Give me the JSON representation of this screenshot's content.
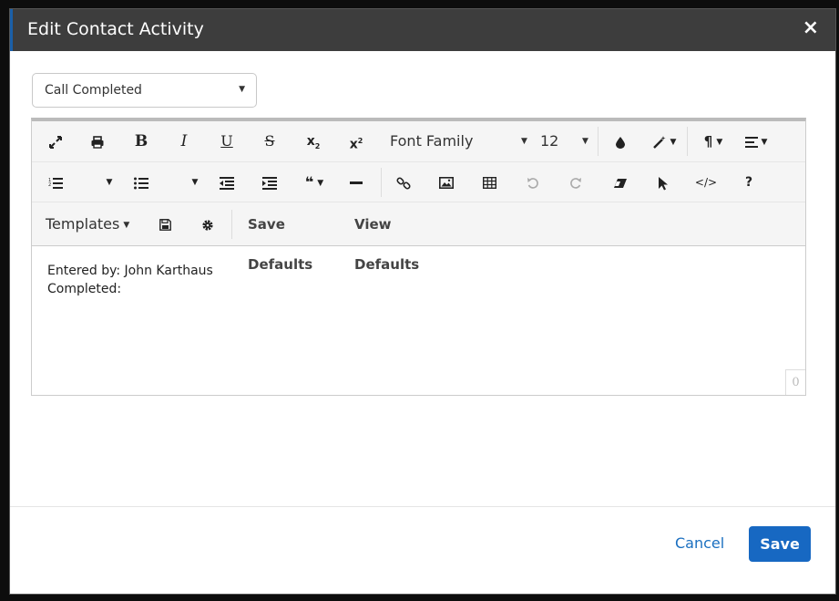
{
  "modal": {
    "title": "Edit Contact Activity",
    "close_glyph": "×"
  },
  "activity_select": {
    "value": "Call Completed"
  },
  "toolbar": {
    "font_family": "Font Family",
    "font_size": "12",
    "templates": "Templates",
    "save_defaults": "Save Defaults",
    "view_defaults": "View Defaults",
    "bold": "B",
    "italic": "I",
    "underline": "U",
    "strike": "S",
    "subscript": "x",
    "superscript": "x",
    "sub_mark": "2",
    "sup_mark": "2",
    "help": "?",
    "code": "</>"
  },
  "editor": {
    "lines": [
      "Entered by: John Karthaus",
      "Completed:"
    ],
    "char_count": "0"
  },
  "footer": {
    "cancel_label": "Cancel",
    "save_label": "Save"
  },
  "colors": {
    "header_bg": "#3d3d3d",
    "primary": "#1768c2",
    "link": "#1a6fc0"
  }
}
